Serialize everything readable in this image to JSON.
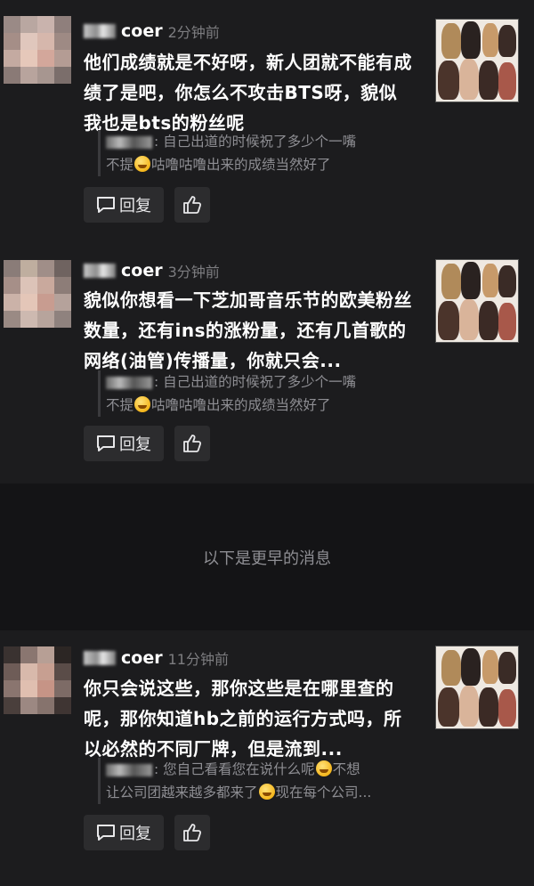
{
  "comments": [
    {
      "username": "coer",
      "time": "2分钟前",
      "content": "他们成绩就是不好呀，新人团就不能有成绩了是吧，你怎么不攻击BTS呀，貌似我也是bts的粉丝呢",
      "quote_line1": ": 自己出道的时候祝了多少个一嘴",
      "quote_line2a": "不提",
      "quote_line2b": "咕噜咕噜出来的成绩当然好了",
      "reply_label": "回复"
    },
    {
      "username": "coer",
      "time": "3分钟前",
      "content": "貌似你想看一下芝加哥音乐节的欧美粉丝数量，还有ins的涨粉量，还有几首歌的网络(油管)传播量，你就只会...",
      "quote_line1": ": 自己出道的时候祝了多少个一嘴",
      "quote_line2a": "不提",
      "quote_line2b": "咕噜咕噜出来的成绩当然好了",
      "reply_label": "回复"
    },
    {
      "username": "coer",
      "time": "11分钟前",
      "content": "你只会说这些，那你这些是在哪里查的呢，那你知道hb之前的运行方式吗，所以必然的不同厂牌，但是流到...",
      "quote_line1a": ": 您自己看看您在说什么呢",
      "quote_line1b": "不想",
      "quote_line2a": "让公司团越来越多都来了",
      "quote_line2b": "现在每个公司...",
      "reply_label": "回复"
    }
  ],
  "divider_text": "以下是更早的消息",
  "icons": {
    "reply": "comment-icon",
    "like": "thumbs-up-icon"
  }
}
